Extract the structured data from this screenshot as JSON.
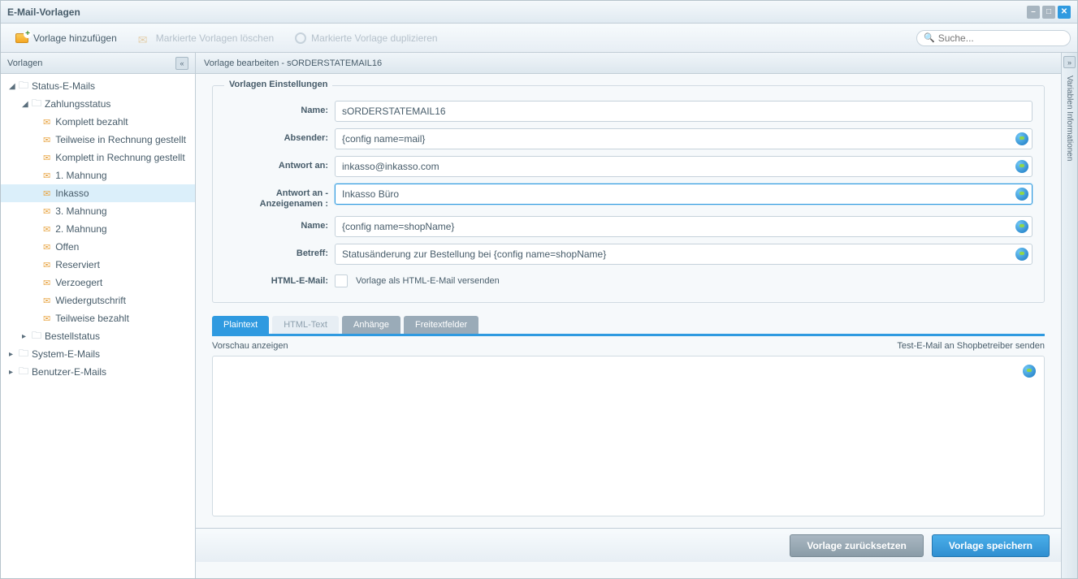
{
  "window": {
    "title": "E-Mail-Vorlagen"
  },
  "toolbar": {
    "add": "Vorlage hinzufügen",
    "delete": "Markierte Vorlagen löschen",
    "duplicate": "Markierte Vorlage duplizieren",
    "search_placeholder": "Suche..."
  },
  "sidebar": {
    "title": "Vorlagen",
    "tree": {
      "root1": "Status-E-Mails",
      "sub1": "Zahlungsstatus",
      "items": [
        "Komplett bezahlt",
        "Teilweise in Rechnung gestellt",
        "Komplett in Rechnung gestellt",
        "1. Mahnung",
        "Inkasso",
        "3. Mahnung",
        "2. Mahnung",
        "Offen",
        "Reserviert",
        "Verzoegert",
        "Wiedergutschrift",
        "Teilweise bezahlt"
      ],
      "sub2": "Bestellstatus",
      "root2": "System-E-Mails",
      "root3": "Benutzer-E-Mails"
    }
  },
  "main": {
    "header": "Vorlage bearbeiten - sORDERSTATEMAIL16",
    "fieldset_legend": "Vorlagen Einstellungen",
    "labels": {
      "name1": "Name:",
      "sender": "Absender:",
      "replyto": "Antwort an:",
      "replyto_displayname": "Antwort an - Anzeigenamen :",
      "name2": "Name:",
      "subject": "Betreff:",
      "html": "HTML-E-Mail:"
    },
    "values": {
      "name1": "sORDERSTATEMAIL16",
      "sender": "{config name=mail}",
      "replyto": "inkasso@inkasso.com",
      "replyto_displayname": "Inkasso Büro",
      "name2": "{config name=shopName}",
      "subject": "Statusänderung zur Bestellung bei {config name=shopName}",
      "html_label": "Vorlage als HTML-E-Mail versenden"
    },
    "tabs": [
      "Plaintext",
      "HTML-Text",
      "Anhänge",
      "Freitextfelder"
    ],
    "preview": "Vorschau anzeigen",
    "testmail": "Test-E-Mail an Shopbetreiber senden"
  },
  "footer": {
    "reset": "Vorlage zurücksetzen",
    "save": "Vorlage speichern"
  },
  "rightpanel": {
    "label": "Variablen Informationen"
  }
}
